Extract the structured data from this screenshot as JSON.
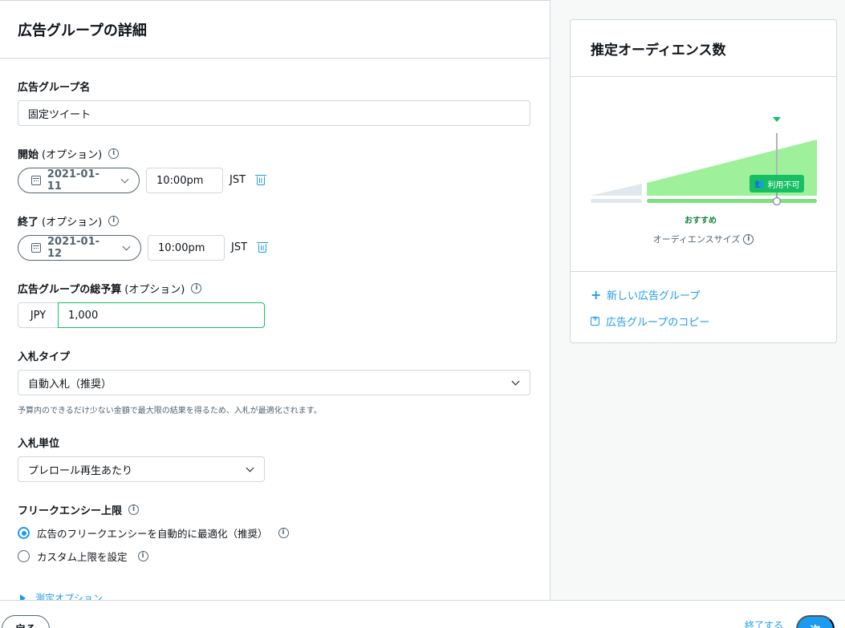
{
  "header": {
    "title": "広告グループの詳細"
  },
  "ad_group_name": {
    "label": "広告グループ名",
    "value": "固定ツイート"
  },
  "start": {
    "label": "開始",
    "optional": "(オプション)",
    "date": "2021-01-11",
    "time": "10:00pm",
    "timezone": "JST"
  },
  "end": {
    "label": "終了",
    "optional": "(オプション)",
    "date": "2021-01-12",
    "time": "10:00pm",
    "timezone": "JST"
  },
  "budget": {
    "label": "広告グループの総予算",
    "optional": "(オプション)",
    "currency": "JPY",
    "value": "1,000"
  },
  "bid_type": {
    "label": "入札タイプ",
    "selected": "自動入札（推奨）",
    "help": "予算内のできるだけ少ない金額で最大限の結果を得るため、入札が最適化されます。"
  },
  "bid_unit": {
    "label": "入札単位",
    "selected": "プレロール再生あたり"
  },
  "frequency_cap": {
    "label": "フリークエンシー上限",
    "options": [
      {
        "label": "広告のフリークエンシーを自動的に最適化（推奨）",
        "selected": true
      },
      {
        "label": "カスタム上限を設定",
        "selected": false
      }
    ]
  },
  "measurement": {
    "label": "測定オプション"
  },
  "audience": {
    "title": "推定オーディエンス数",
    "badge": "利用不可",
    "recommended": "おすすめ",
    "size_label": "オーディエンスサイズ",
    "links": {
      "new_group": "新しい広告グループ",
      "copy_group": "広告グループのコピー"
    },
    "colors": {
      "recommended_fill": "#9ef09b",
      "recommended_bar": "#7fe07f",
      "low_fill": "#e1e8ed",
      "badge": "#17bf63"
    }
  },
  "footer": {
    "back": "戻る",
    "finish": "終了する",
    "next": "次"
  },
  "colors": {
    "accent": "#1d9bf0",
    "success": "#17bf63",
    "border": "#cfd9de"
  },
  "info_glyph": "i"
}
